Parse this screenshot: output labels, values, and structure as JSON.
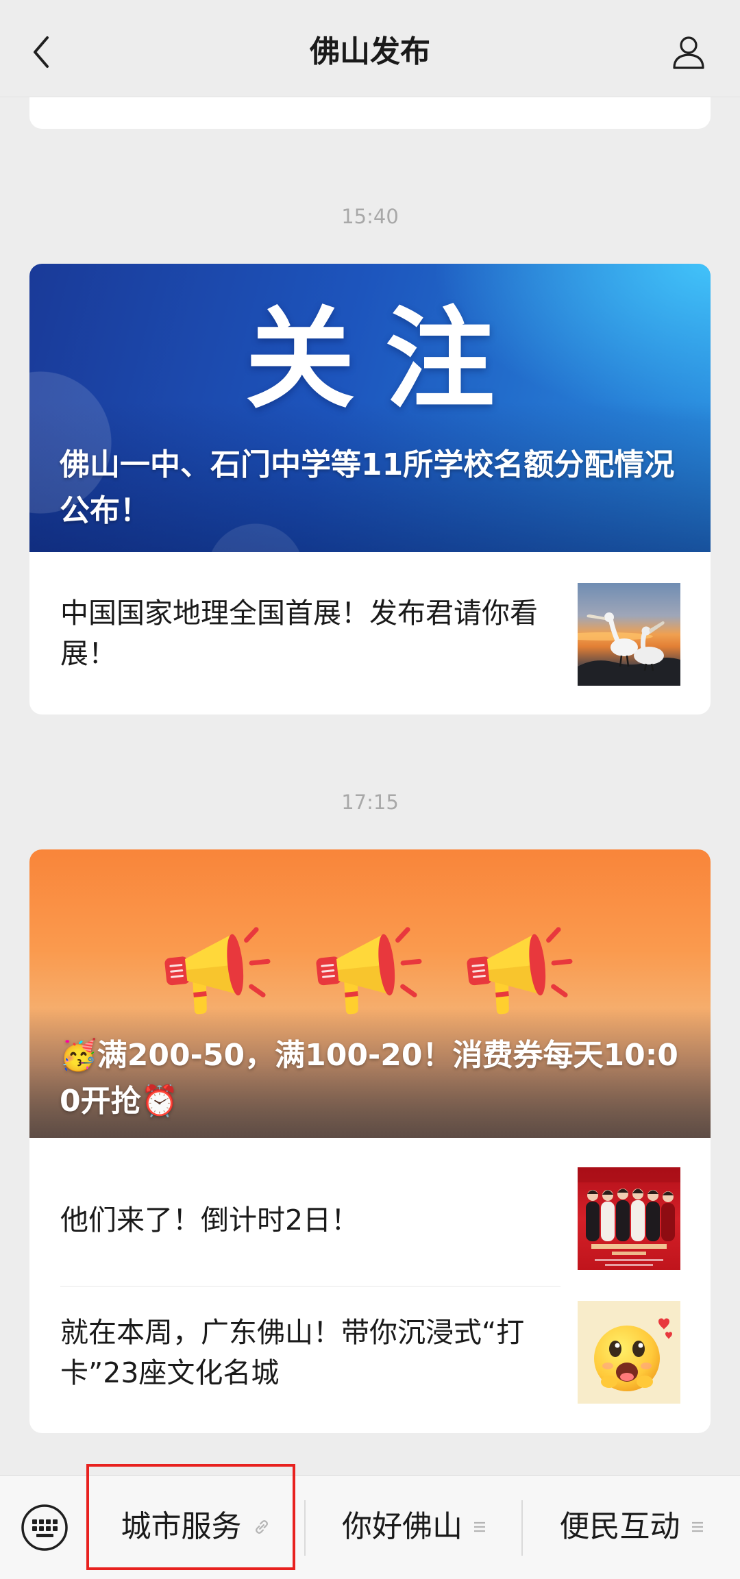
{
  "header": {
    "title": "佛山发布",
    "back_icon": "chevron-left-icon",
    "profile_icon": "person-icon"
  },
  "feed": [
    {
      "time": "15:40",
      "cover": {
        "headline": "关注",
        "title": "佛山一中、石门中学等11所学校名额分配情况公布！"
      },
      "items": [
        {
          "title": "中国国家地理全国首展！发布君请你看展！"
        }
      ]
    },
    {
      "time": "17:15",
      "cover": {
        "title": "🥳满200-50，满100-20！消费券每天10:00开抢⏰",
        "decoration_icon": "megaphone-icon"
      },
      "items": [
        {
          "title": "他们来了！倒计时2日！"
        },
        {
          "title": "就在本周，广东佛山！带你沉浸式“打卡”23座文化名城"
        }
      ]
    }
  ],
  "bottom_menu": {
    "keyboard_icon": "keyboard-icon",
    "items": [
      {
        "label": "城市服务",
        "icon": "link-icon"
      },
      {
        "label": "你好佛山",
        "icon": "menu-lines-icon"
      },
      {
        "label": "便民互动",
        "icon": "menu-lines-icon"
      }
    ]
  },
  "colors": {
    "page_background": "#ededed",
    "card_background": "#ffffff",
    "timestamp_text": "#a8a8a8",
    "highlight_border": "#e8211f"
  }
}
